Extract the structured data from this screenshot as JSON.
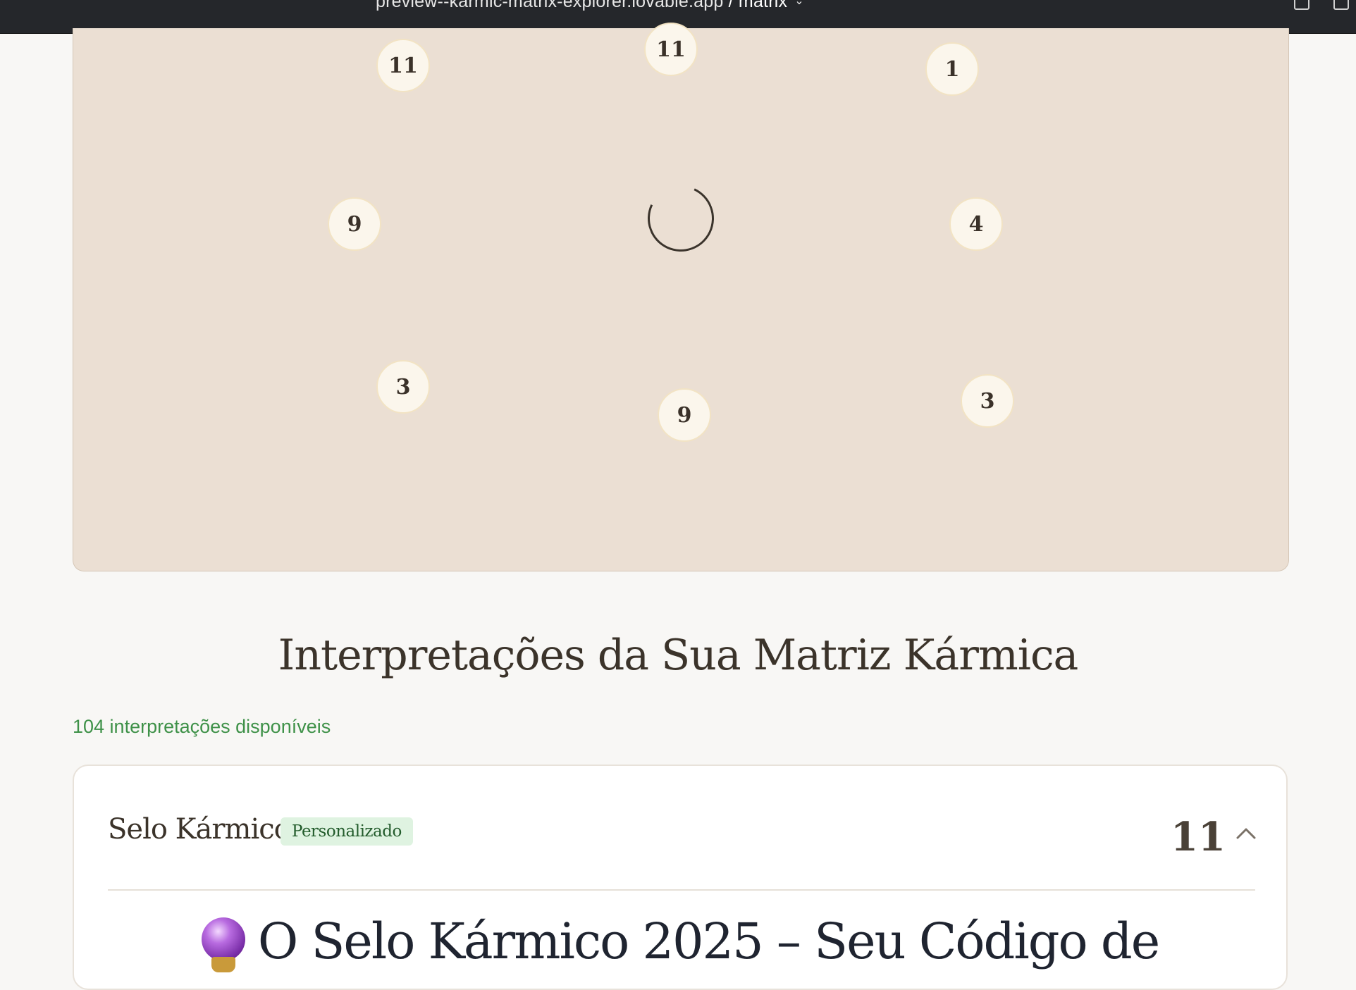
{
  "browser": {
    "url_host": "preview--karmic-matrix-explorer.lovable.app",
    "url_path": " / matrix"
  },
  "matrix": {
    "nodes": [
      "11",
      "11",
      "1",
      "9",
      "4",
      "3",
      "9",
      "3"
    ]
  },
  "interpretations": {
    "title": "Interpretações da Sua Matriz Kármica",
    "count_text": "104 interpretações disponíveis",
    "card": {
      "title": "Selo Kármico",
      "badge": "Personalizado",
      "number": "11",
      "heading": "O Selo Kármico 2025 – Seu Código de"
    }
  },
  "colors": {
    "panel_bg": "#ebdfd3",
    "accent_green": "#3e9148",
    "node_bg": "#fbf6ec"
  }
}
